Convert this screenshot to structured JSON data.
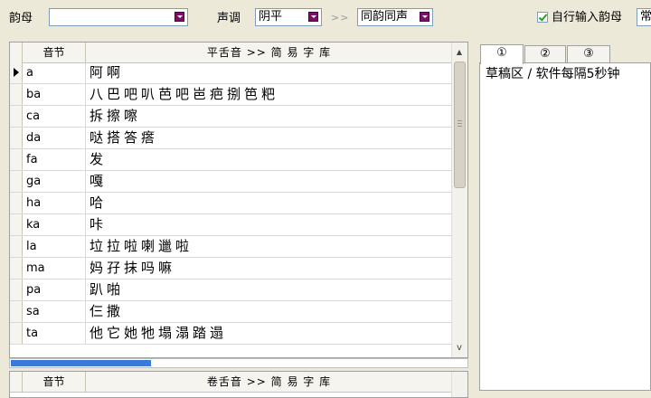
{
  "toolbar": {
    "final_label": "韵母",
    "final_value": "",
    "tone_label": "声调",
    "tone_value": "阴平",
    "arrow": ">>",
    "rhyme_value": "同韵同声",
    "auto_final_label": "自行输入韵母",
    "auto_final_checked": true,
    "truncated_combo_value": "常"
  },
  "grid_top": {
    "col_syllable": "音节",
    "col_chars": "平舌音 >> 简 易 字 库",
    "rows": [
      {
        "syllable": "a",
        "chars": "阿啊"
      },
      {
        "syllable": "ba",
        "chars": "八巴吧叭芭吧岜疤捌笆粑"
      },
      {
        "syllable": "ca",
        "chars": "拆擦嚓"
      },
      {
        "syllable": "da",
        "chars": "哒搭答瘩"
      },
      {
        "syllable": "fa",
        "chars": "发"
      },
      {
        "syllable": "ga",
        "chars": "嘎"
      },
      {
        "syllable": "ha",
        "chars": "哈"
      },
      {
        "syllable": "ka",
        "chars": "咔"
      },
      {
        "syllable": "la",
        "chars": "垃拉啦喇邋啦"
      },
      {
        "syllable": "ma",
        "chars": "妈孖抹吗嘛"
      },
      {
        "syllable": "pa",
        "chars": "趴啪"
      },
      {
        "syllable": "sa",
        "chars": "仨撒"
      },
      {
        "syllable": "ta",
        "chars": "他它她牠塌溻踏遢"
      }
    ],
    "scroll_up": "▲",
    "scroll_down": "v"
  },
  "grid_bottom": {
    "col_syllable": "音节",
    "col_chars": "卷舌音 >> 简 易 字 库"
  },
  "tabs": [
    {
      "label": "①"
    },
    {
      "label": "②"
    },
    {
      "label": "③"
    }
  ],
  "draft": {
    "text": "草稿区 / 软件每隔5秒钟"
  },
  "colors": {
    "progress": "#3b7bd8",
    "dropdown": "#7a0f6a",
    "check": "#21a121"
  }
}
